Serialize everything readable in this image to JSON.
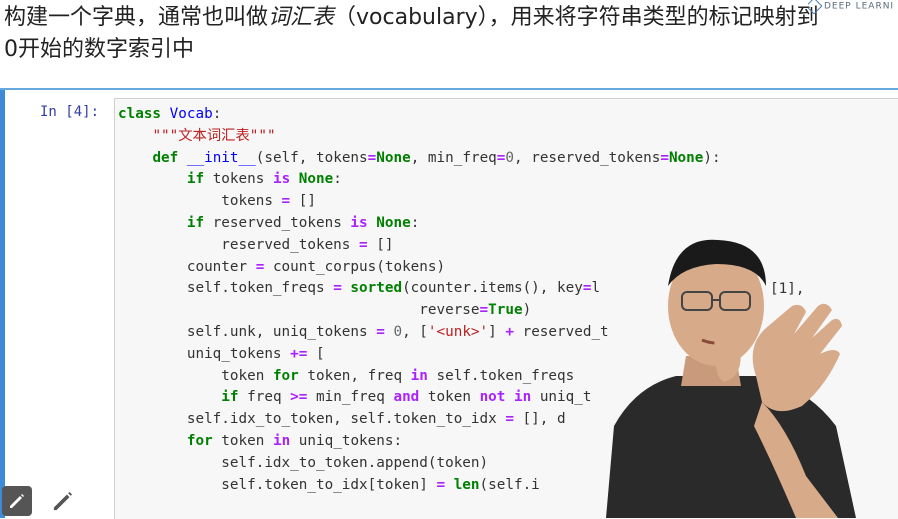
{
  "intro": {
    "line1_before": "构建一个字典，通常也叫做",
    "line1_emph": "词汇表",
    "line1_after": "（vocabulary），用来将字符串类型的标记映射到",
    "line2": "0开始的数字索引中"
  },
  "logo": {
    "text": "DEEP LEARNI"
  },
  "cell": {
    "prompt": "In [4]:",
    "code_lines": [
      [
        [
          "kw",
          "class"
        ],
        [
          "p",
          " "
        ],
        [
          "nm",
          "Vocab"
        ],
        [
          "p",
          ":"
        ]
      ],
      [
        [
          "p",
          "    "
        ],
        [
          "st",
          "\"\"\"文本词汇表\"\"\""
        ]
      ],
      [
        [
          "p",
          "    "
        ],
        [
          "kw",
          "def"
        ],
        [
          "p",
          " "
        ],
        [
          "fn",
          "__init__"
        ],
        [
          "p",
          "(self, tokens"
        ],
        [
          "op",
          "="
        ],
        [
          "kw",
          "None"
        ],
        [
          "p",
          ", min_freq"
        ],
        [
          "op",
          "="
        ],
        [
          "num",
          "0"
        ],
        [
          "p",
          ", reserved_tokens"
        ],
        [
          "op",
          "="
        ],
        [
          "kw",
          "None"
        ],
        [
          "p",
          "):"
        ]
      ],
      [
        [
          "p",
          "        "
        ],
        [
          "kw",
          "if"
        ],
        [
          "p",
          " tokens "
        ],
        [
          "op",
          "is"
        ],
        [
          "p",
          " "
        ],
        [
          "kw",
          "None"
        ],
        [
          "p",
          ":"
        ]
      ],
      [
        [
          "p",
          "            tokens "
        ],
        [
          "op",
          "="
        ],
        [
          "p",
          " []"
        ]
      ],
      [
        [
          "p",
          "        "
        ],
        [
          "kw",
          "if"
        ],
        [
          "p",
          " reserved_tokens "
        ],
        [
          "op",
          "is"
        ],
        [
          "p",
          " "
        ],
        [
          "kw",
          "None"
        ],
        [
          "p",
          ":"
        ]
      ],
      [
        [
          "p",
          "            reserved_tokens "
        ],
        [
          "op",
          "="
        ],
        [
          "p",
          " []"
        ]
      ],
      [
        [
          "p",
          "        counter "
        ],
        [
          "op",
          "="
        ],
        [
          "p",
          " count_corpus(tokens)"
        ]
      ],
      [
        [
          "p",
          "        self.token_freqs "
        ],
        [
          "op",
          "="
        ],
        [
          "p",
          " "
        ],
        [
          "kw",
          "sorted"
        ],
        [
          "p",
          "(counter.items(), key"
        ],
        [
          "op",
          "="
        ],
        [
          "p",
          "l"
        ]
      ],
      [
        [
          "p",
          "                                   reverse"
        ],
        [
          "op",
          "="
        ],
        [
          "kw",
          "True"
        ],
        [
          "p",
          ")"
        ]
      ],
      [
        [
          "p",
          "        self.unk, uniq_tokens "
        ],
        [
          "op",
          "="
        ],
        [
          "p",
          " "
        ],
        [
          "num",
          "0"
        ],
        [
          "p",
          ", ["
        ],
        [
          "st",
          "'<unk>'"
        ],
        [
          "p",
          "] "
        ],
        [
          "op",
          "+"
        ],
        [
          "p",
          " reserved_t"
        ]
      ],
      [
        [
          "p",
          "        uniq_tokens "
        ],
        [
          "op",
          "+="
        ],
        [
          "p",
          " ["
        ]
      ],
      [
        [
          "p",
          "            token "
        ],
        [
          "kw",
          "for"
        ],
        [
          "p",
          " token, freq "
        ],
        [
          "op",
          "in"
        ],
        [
          "p",
          " self.token_freqs"
        ]
      ],
      [
        [
          "p",
          "            "
        ],
        [
          "kw",
          "if"
        ],
        [
          "p",
          " freq "
        ],
        [
          "op",
          ">="
        ],
        [
          "p",
          " min_freq "
        ],
        [
          "op",
          "and"
        ],
        [
          "p",
          " token "
        ],
        [
          "op",
          "not in"
        ],
        [
          "p",
          " uniq_t"
        ]
      ],
      [
        [
          "p",
          "        self.idx_to_token, self.token_to_idx "
        ],
        [
          "op",
          "="
        ],
        [
          "p",
          " [], d"
        ]
      ],
      [
        [
          "p",
          "        "
        ],
        [
          "kw",
          "for"
        ],
        [
          "p",
          " token "
        ],
        [
          "op",
          "in"
        ],
        [
          "p",
          " uniq_tokens:"
        ]
      ],
      [
        [
          "p",
          "            self.idx_to_token.append(token)"
        ]
      ],
      [
        [
          "p",
          "            self.token_to_idx[token] "
        ],
        [
          "op",
          "="
        ],
        [
          "p",
          " "
        ],
        [
          "kw",
          "len"
        ],
        [
          "p",
          "(self.i"
        ]
      ]
    ],
    "partial_suffix": "[1],"
  },
  "icons": {
    "edit_active": "pencil-icon",
    "edit": "pencil-icon"
  }
}
